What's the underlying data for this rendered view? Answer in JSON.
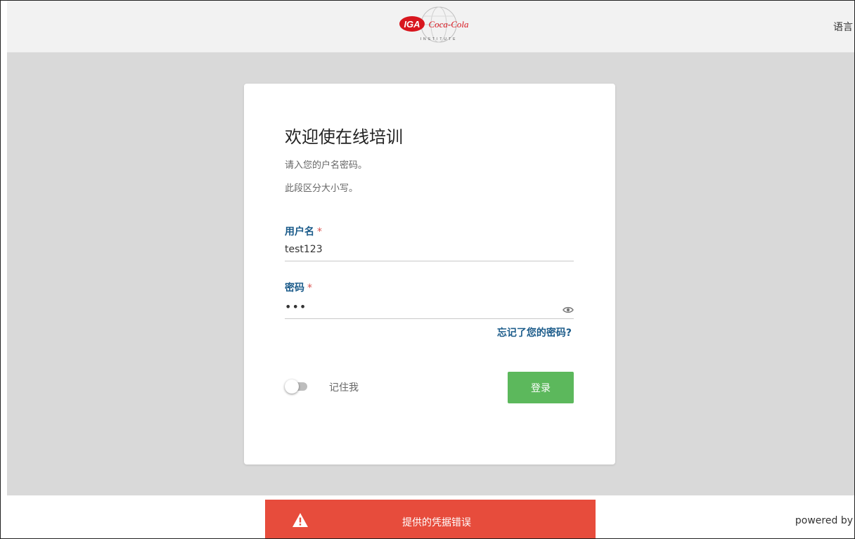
{
  "header": {
    "logo_brand_1": "IGA",
    "logo_brand_2": "Coca-Cola",
    "logo_sub": "INSTITUTE",
    "language_label": "语言"
  },
  "login": {
    "title": "欢迎使在线培训",
    "subtitle_1": "请入您的户名密码。",
    "subtitle_2": "此段区分大小写。",
    "username_label": "用户名",
    "username_value": "test123",
    "password_label": "密码",
    "password_value": "•••",
    "required_mark": "*",
    "forgot_link": "忘记了您的密码?",
    "remember_label": "记住我",
    "login_button": "登录"
  },
  "footer": {
    "error_message": "提供的凭据错误",
    "powered_by": "powered by"
  },
  "colors": {
    "link": "#1b5b8a",
    "button_green": "#5cb85c",
    "error_red": "#e74c3c",
    "page_bg": "#d9d9d9"
  },
  "icons": [
    "eye-icon",
    "warning-icon",
    "logo-globe"
  ]
}
